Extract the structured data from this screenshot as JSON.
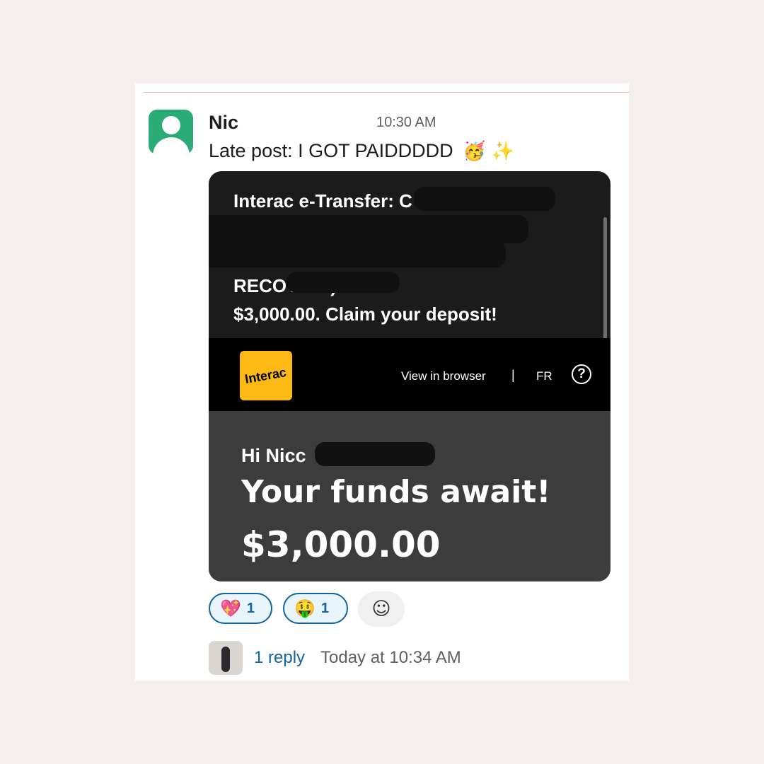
{
  "post": {
    "sender_name": "Nic",
    "time": "10:30 AM",
    "message_text": "Late post: I GOT PAIDDDDD",
    "message_emojis": "🥳 ✨"
  },
  "email": {
    "subject_line_1": "Interac e-Transfer: C",
    "subject_line_4": "RECOV                DA) sent",
    "subject_line_5": "$3,000.00. Claim your deposit!",
    "logo_text": "Interac",
    "view_in_browser": "View in browser",
    "separator": "|",
    "language": "FR",
    "help_icon": "?",
    "greeting": "Hi Nicc",
    "greeting_end": ",",
    "headline": "Your funds await!",
    "amount": "$3,000.00"
  },
  "reactions": [
    {
      "emoji": "💖",
      "count": "1"
    },
    {
      "emoji": "🤑",
      "count": "1"
    }
  ],
  "add_reaction_icon": "☺",
  "thread": {
    "reply_count": "1 reply",
    "reply_time": "Today at 10:34 AM"
  },
  "colors": {
    "avatar": "#2bac76",
    "link": "#1264a3",
    "interac_yellow": "#fdb913"
  }
}
